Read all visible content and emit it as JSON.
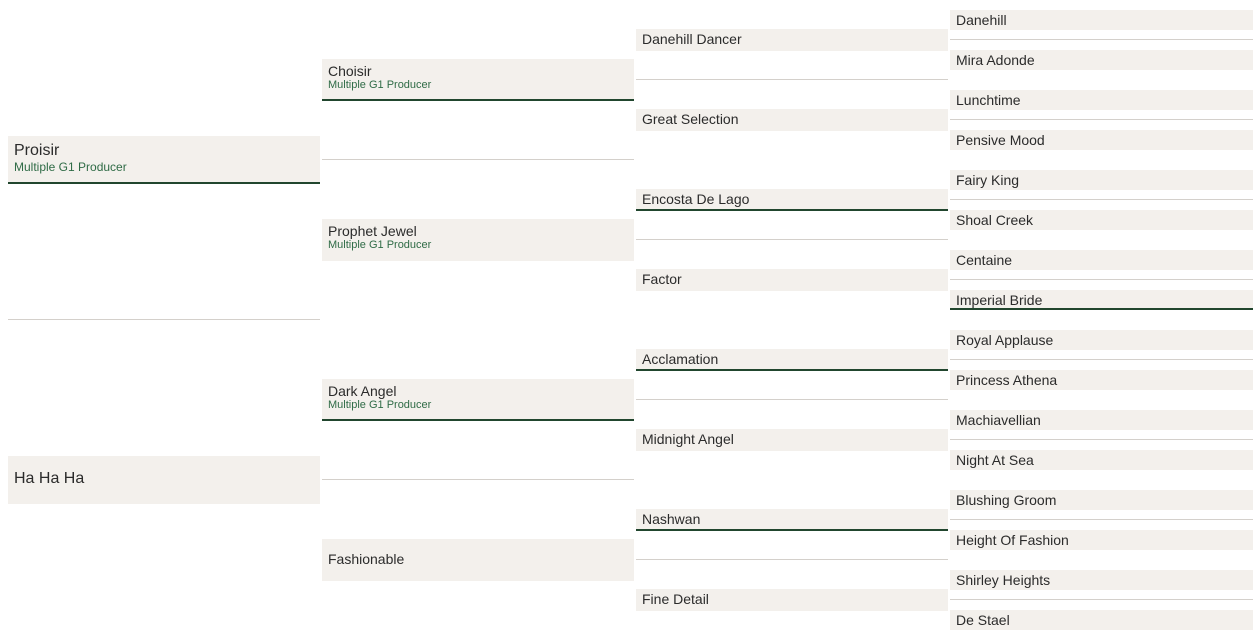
{
  "pedigree": {
    "sire": {
      "name": "Proisir",
      "note": "Multiple G1 Producer",
      "underline": true
    },
    "dam": {
      "name": "Ha Ha Ha",
      "note": "",
      "underline": false
    },
    "gen2": [
      {
        "name": "Choisir",
        "note": "Multiple G1 Producer",
        "underline": true
      },
      {
        "name": "Prophet Jewel",
        "note": "Multiple G1 Producer",
        "underline": false
      },
      {
        "name": "Dark Angel",
        "note": "Multiple G1 Producer",
        "underline": true
      },
      {
        "name": "Fashionable",
        "note": "",
        "underline": false
      }
    ],
    "gen3": [
      {
        "name": "Danehill Dancer",
        "underline": false
      },
      {
        "name": "Great Selection",
        "underline": false
      },
      {
        "name": "Encosta De Lago",
        "underline": true
      },
      {
        "name": "Factor",
        "underline": false
      },
      {
        "name": "Acclamation",
        "underline": true
      },
      {
        "name": "Midnight Angel",
        "underline": false
      },
      {
        "name": "Nashwan",
        "underline": true
      },
      {
        "name": "Fine Detail",
        "underline": false
      }
    ],
    "gen4": [
      {
        "name": "Danehill",
        "underline": false
      },
      {
        "name": "Mira Adonde",
        "underline": false
      },
      {
        "name": "Lunchtime",
        "underline": false
      },
      {
        "name": "Pensive Mood",
        "underline": false
      },
      {
        "name": "Fairy King",
        "underline": false
      },
      {
        "name": "Shoal Creek",
        "underline": false
      },
      {
        "name": "Centaine",
        "underline": false
      },
      {
        "name": "Imperial Bride",
        "underline": true
      },
      {
        "name": "Royal Applause",
        "underline": false
      },
      {
        "name": "Princess Athena",
        "underline": false
      },
      {
        "name": "Machiavellian",
        "underline": false
      },
      {
        "name": "Night At Sea",
        "underline": false
      },
      {
        "name": "Blushing Groom",
        "underline": false
      },
      {
        "name": "Height Of Fashion",
        "underline": false
      },
      {
        "name": "Shirley Heights",
        "underline": false
      },
      {
        "name": "De Stael",
        "underline": false
      }
    ]
  }
}
